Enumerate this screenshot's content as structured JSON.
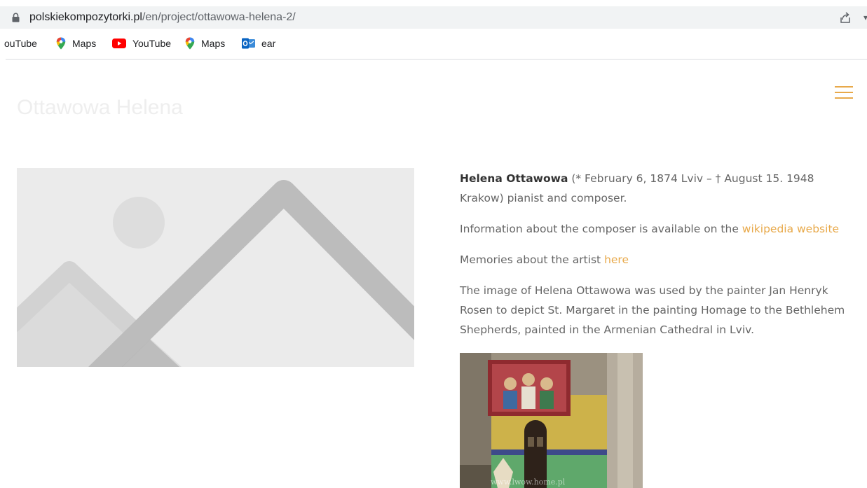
{
  "browser": {
    "url_host": "polskiekompozytorki.pl",
    "url_path": "/en/project/ottawowa-helena-2/",
    "bookmarks": [
      {
        "label": "ouTube",
        "icon": "youtube-icon"
      },
      {
        "label": "Maps",
        "icon": "maps-pin-icon"
      },
      {
        "label": "YouTube",
        "icon": "youtube-icon"
      },
      {
        "label": "Maps",
        "icon": "maps-pin-icon"
      },
      {
        "label": "ear",
        "icon": "outlook-icon"
      }
    ]
  },
  "page": {
    "title": "Ottawowa Helena",
    "accent_color": "#e8a94a"
  },
  "content": {
    "bio_name": "Helena Ottawowa",
    "bio_rest": " (* February 6, 1874 Lviv – † August 15. 1948 Krakow) pianist and composer.",
    "info_text": "Information about the composer is available on the ",
    "info_link": "wikipedia website",
    "memories_text": "Memories about the artist ",
    "memories_link": "here",
    "painting_text": "The image of Helena Ottawowa was used by the painter Jan Henryk Rosen to depict St. Margaret in the painting Homage to the Bethlehem Shepherds, painted in the Armenian Cathedral in Lviv.",
    "photo_watermark": "www.lwow.home.pl"
  }
}
